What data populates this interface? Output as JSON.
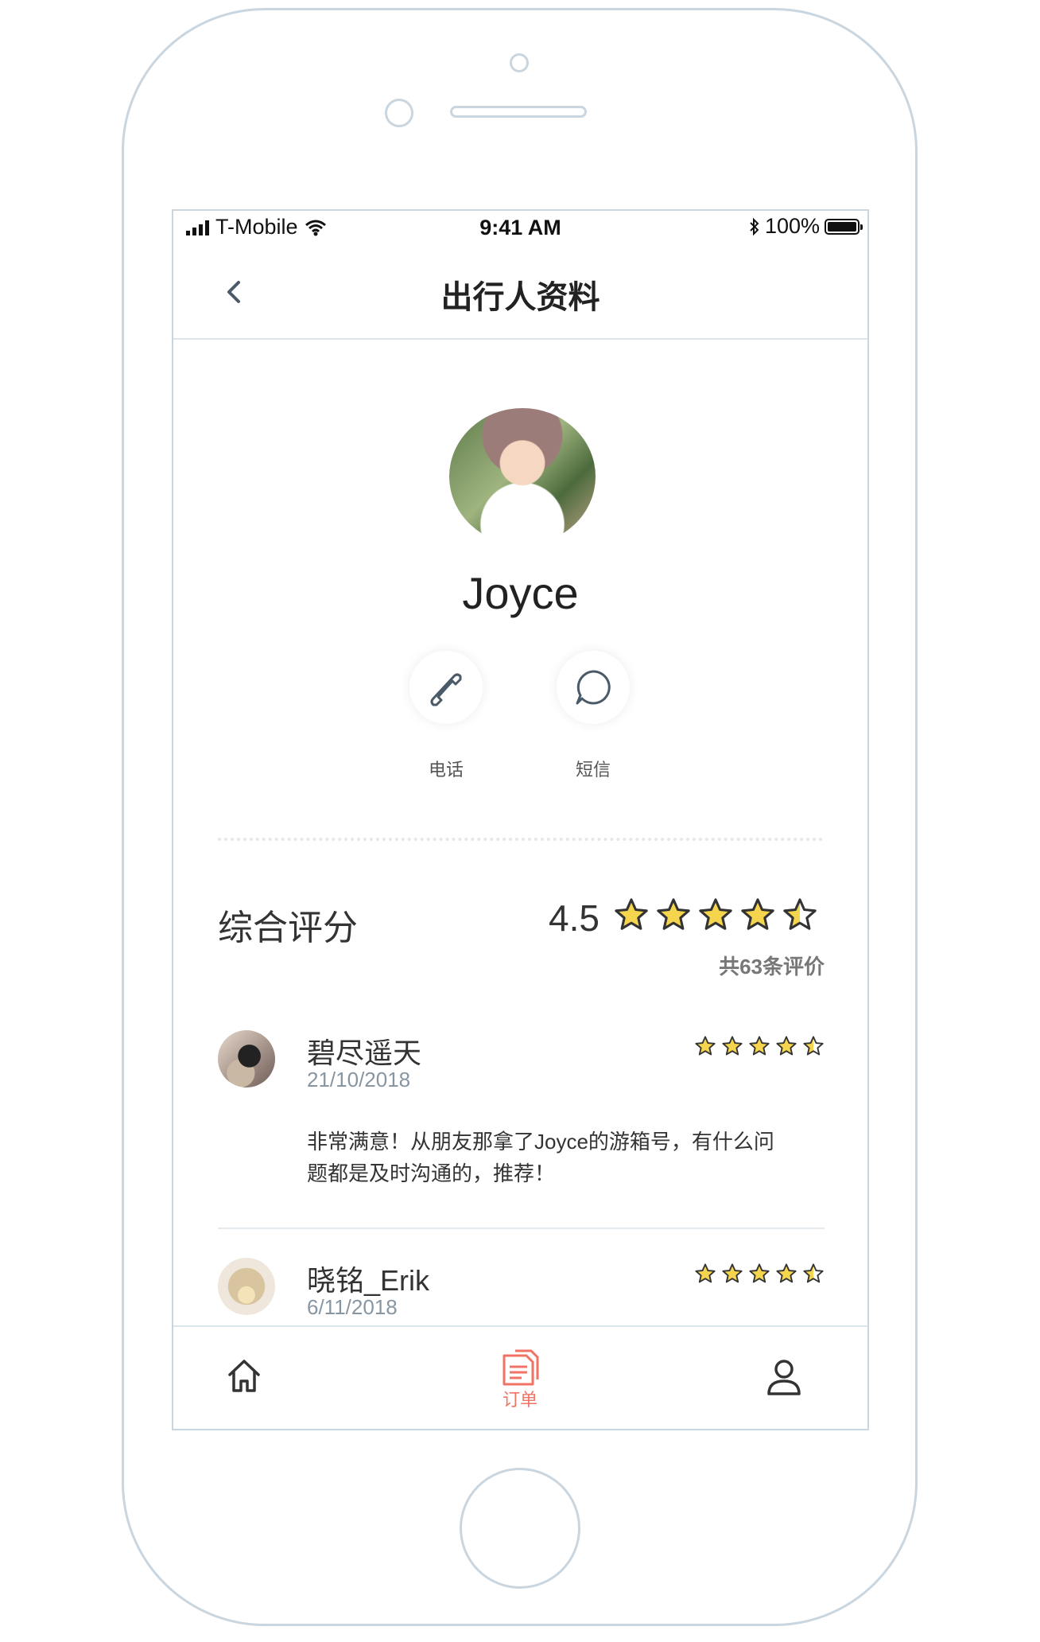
{
  "status_bar": {
    "carrier": "T-Mobile",
    "time": "9:41 AM",
    "battery": "100%"
  },
  "nav": {
    "title": "出行人资料"
  },
  "profile": {
    "name": "Joyce"
  },
  "actions": [
    {
      "label": "电话",
      "icon": "phone-icon"
    },
    {
      "label": "短信",
      "icon": "message-icon"
    }
  ],
  "rating": {
    "title": "综合评分",
    "score": "4.5",
    "stars": 4.5,
    "count_text": "共63条评价"
  },
  "reviews": [
    {
      "name": "碧尽遥天",
      "date": "21/10/2018",
      "stars": 4.5,
      "text_line1": "非常满意！从朋友那拿了Joyce的游箱号，有什么问",
      "text_line2": "题都是及时沟通的，推荐！"
    },
    {
      "name": "晓铭_Erik",
      "date": "6/11/2018",
      "stars": 4.5
    }
  ],
  "tab_bar": {
    "items": [
      {
        "icon": "home-icon"
      },
      {
        "icon": "orders-icon",
        "label": "订单",
        "active": true
      },
      {
        "icon": "user-icon"
      }
    ]
  },
  "colors": {
    "star": "#f5d54e",
    "accent": "#f07365",
    "border": "#c9d6e0"
  }
}
